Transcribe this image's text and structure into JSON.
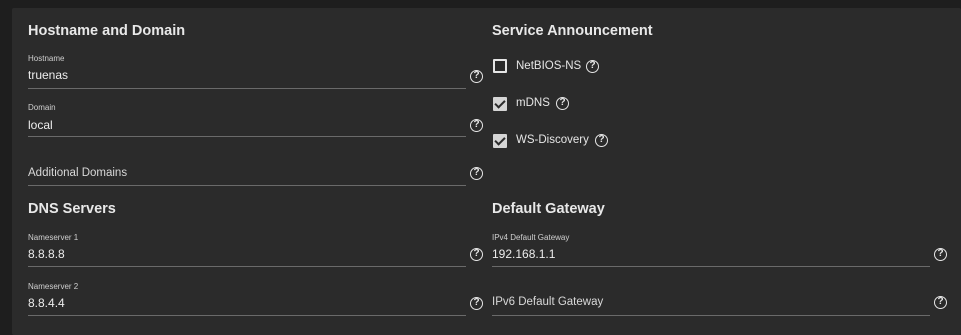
{
  "hostname_domain": {
    "title": "Hostname and Domain",
    "hostname": {
      "label": "Hostname",
      "value": "truenas"
    },
    "domain": {
      "label": "Domain",
      "value": "local"
    },
    "additional_domains": {
      "placeholder": "Additional Domains"
    }
  },
  "service_announcement": {
    "title": "Service Announcement",
    "options": [
      {
        "label": "NetBIOS-NS",
        "checked": false
      },
      {
        "label": "mDNS",
        "checked": true
      },
      {
        "label": "WS-Discovery",
        "checked": true
      }
    ]
  },
  "dns_servers": {
    "title": "DNS Servers",
    "nameserver1": {
      "label": "Nameserver 1",
      "value": "8.8.8.8"
    },
    "nameserver2": {
      "label": "Nameserver 2",
      "value": "8.8.4.4"
    }
  },
  "default_gateway": {
    "title": "Default Gateway",
    "ipv4": {
      "label": "IPv4 Default Gateway",
      "value": "192.168.1.1"
    },
    "ipv6": {
      "placeholder": "IPv6 Default Gateway"
    }
  },
  "help_glyph": "?"
}
